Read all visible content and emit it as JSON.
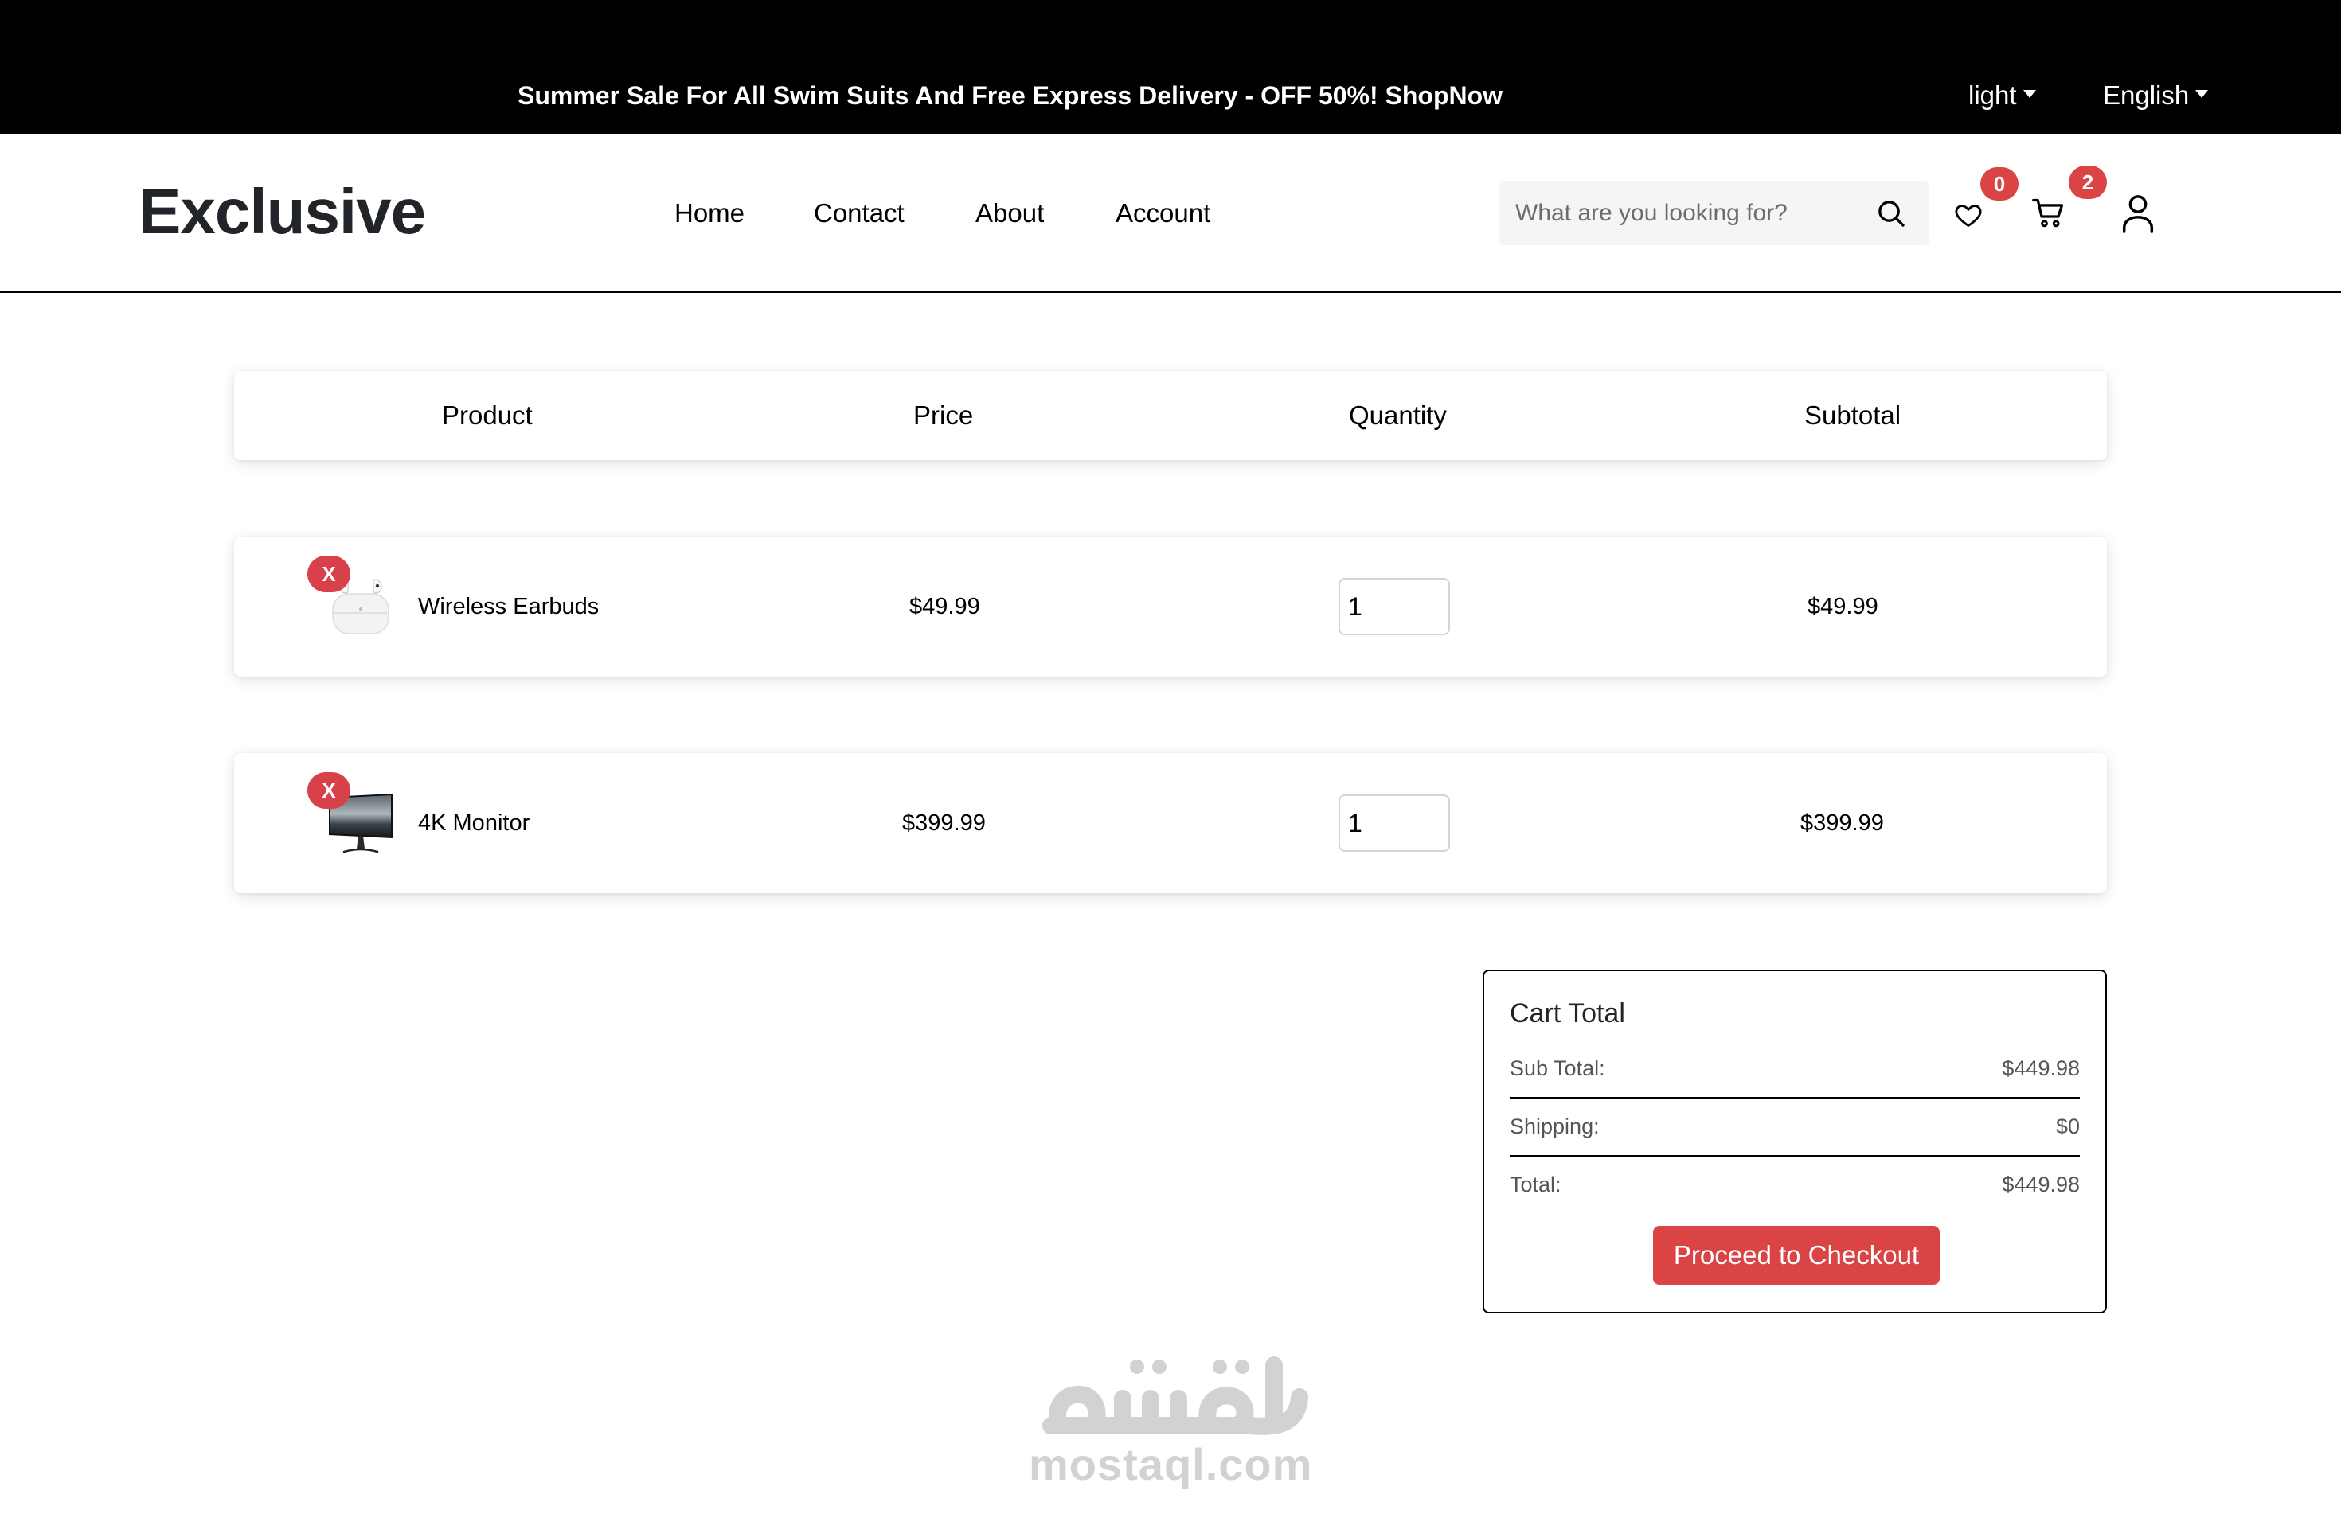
{
  "topbar": {
    "promo": "Summer Sale For All Swim Suits And Free Express Delivery - OFF 50%! ShopNow",
    "theme": "light",
    "language": "English"
  },
  "header": {
    "logo": "Exclusive",
    "nav": [
      "Home",
      "Contact",
      "About",
      "Account"
    ],
    "search_placeholder": "What are you looking for?",
    "wishlist_count": "0",
    "cart_count": "2",
    "icons": [
      "search-icon",
      "heart-icon",
      "cart-icon",
      "user-icon"
    ]
  },
  "cart": {
    "columns": [
      "Product",
      "Price",
      "Quantity",
      "Subtotal"
    ],
    "items": [
      {
        "remove": "X",
        "name": "Wireless Earbuds",
        "price": "$49.99",
        "quantity": "1",
        "subtotal": "$49.99",
        "image": "earbuds-image"
      },
      {
        "remove": "X",
        "name": "4K Monitor",
        "price": "$399.99",
        "quantity": "1",
        "subtotal": "$399.99",
        "image": "monitor-image"
      }
    ]
  },
  "totals": {
    "title": "Cart Total",
    "subtotal_label": "Sub Total:",
    "subtotal_value": "$449.98",
    "shipping_label": "Shipping:",
    "shipping_value": "$0",
    "total_label": "Total:",
    "total_value": "$449.98",
    "checkout_label": "Proceed to Checkout"
  },
  "watermark": {
    "arabic": "مستقل",
    "latin": "mostaql.com"
  },
  "colors": {
    "accent": "#db4444",
    "topbar_bg": "#000000",
    "search_bg": "#f5f5f5"
  }
}
